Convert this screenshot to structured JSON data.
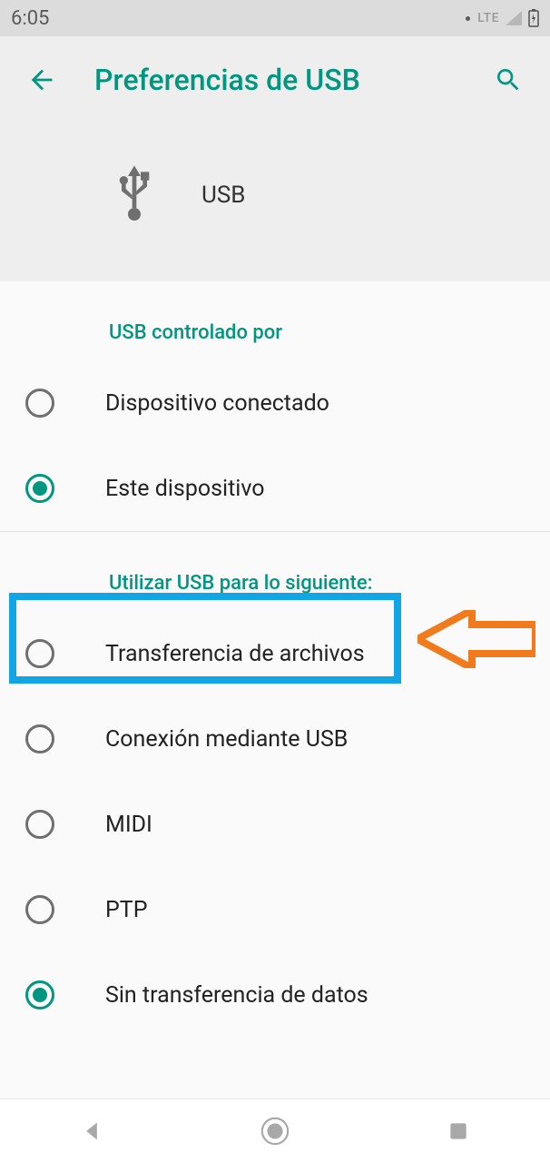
{
  "status": {
    "time": "6:05",
    "network": "LTE"
  },
  "header": {
    "title": "Preferencias de USB",
    "banner_label": "USB"
  },
  "sections": {
    "controlled_by": {
      "title": "USB controlado por",
      "options": [
        {
          "label": "Dispositivo conectado",
          "checked": false
        },
        {
          "label": "Este dispositivo",
          "checked": true
        }
      ]
    },
    "use_for": {
      "title": "Utilizar USB para lo siguiente:",
      "options": [
        {
          "label": "Transferencia de archivos",
          "checked": false
        },
        {
          "label": "Conexión mediante USB",
          "checked": false
        },
        {
          "label": "MIDI",
          "checked": false
        },
        {
          "label": "PTP",
          "checked": false
        },
        {
          "label": "Sin transferencia de datos",
          "checked": true
        }
      ]
    }
  },
  "annotation": {
    "highlight_color": "#11a5e6",
    "arrow_color": "#f07a1c"
  }
}
